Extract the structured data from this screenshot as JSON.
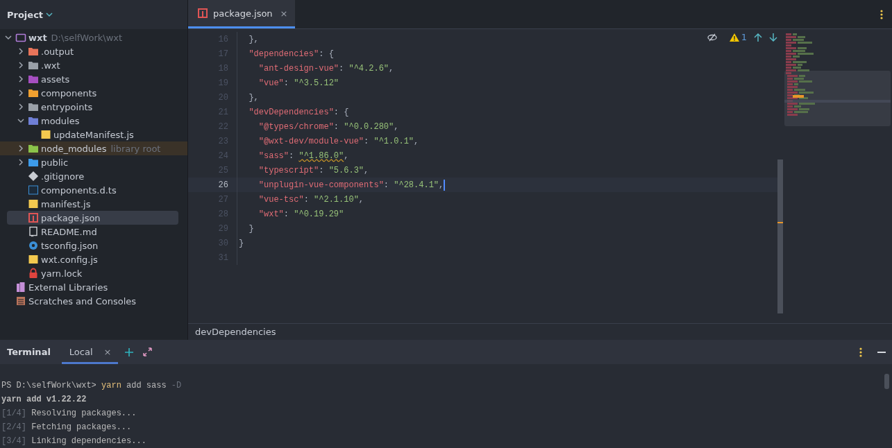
{
  "project": {
    "title": "Project",
    "tree": [
      {
        "name": "wxt",
        "path": "D:\\selfWork\\wxt",
        "kind": "module",
        "expanded": true,
        "selected": false,
        "children": [
          {
            "name": ".output",
            "kind": "folder",
            "color": "#e8745a",
            "expanded": false,
            "selected": false
          },
          {
            "name": ".wxt",
            "kind": "folder",
            "color": "#9aa0a8",
            "expanded": false,
            "selected": false
          },
          {
            "name": "assets",
            "kind": "folder",
            "color": "#a64fc1",
            "expanded": false,
            "selected": false
          },
          {
            "name": "components",
            "kind": "folder",
            "color": "#f0a030",
            "expanded": false,
            "selected": false
          },
          {
            "name": "entrypoints",
            "kind": "folder",
            "color": "#9aa0a8",
            "expanded": false,
            "selected": false
          },
          {
            "name": "modules",
            "kind": "folder",
            "color": "#6f7fd6",
            "expanded": true,
            "selected": false,
            "children": [
              {
                "name": "updateManifest.js",
                "kind": "js",
                "selected": false
              }
            ]
          },
          {
            "name": "node_modules",
            "kind": "folder",
            "color": "#8bc34a",
            "expanded": false,
            "selected": false,
            "library": true,
            "note": "library root"
          },
          {
            "name": "public",
            "kind": "folder",
            "color": "#3d9be9",
            "expanded": false,
            "selected": false
          },
          {
            "name": ".gitignore",
            "kind": "gitignore",
            "selected": false
          },
          {
            "name": "components.d.ts",
            "kind": "ts",
            "selected": false
          },
          {
            "name": "manifest.js",
            "kind": "js",
            "selected": false
          },
          {
            "name": "package.json",
            "kind": "json",
            "selected": true
          },
          {
            "name": "README.md",
            "kind": "md",
            "selected": false
          },
          {
            "name": "tsconfig.json",
            "kind": "tsconfig",
            "selected": false
          },
          {
            "name": "wxt.config.js",
            "kind": "js",
            "selected": false
          },
          {
            "name": "yarn.lock",
            "kind": "lock",
            "selected": false
          }
        ]
      },
      {
        "name": "External Libraries",
        "kind": "libraries",
        "selected": false
      },
      {
        "name": "Scratches and Consoles",
        "kind": "scratches",
        "selected": false
      }
    ]
  },
  "editor": {
    "tabs": [
      {
        "label": "package.json",
        "kind": "json",
        "selected": true,
        "close": "×"
      }
    ],
    "lines": [
      {
        "number": "16",
        "code": "  },",
        "current": false
      },
      {
        "number": "17",
        "code": "  \"dependencies\": {",
        "current": false
      },
      {
        "number": "18",
        "code": "    \"ant-design-vue\": \"^4.2.6\",",
        "current": false
      },
      {
        "number": "19",
        "code": "    \"vue\": \"^3.5.12\"",
        "current": false
      },
      {
        "number": "20",
        "code": "  },",
        "current": false
      },
      {
        "number": "21",
        "code": "  \"devDependencies\": {",
        "current": false
      },
      {
        "number": "22",
        "code": "    \"@types/chrome\": \"^0.0.280\",",
        "current": false
      },
      {
        "number": "23",
        "code": "    \"@wxt-dev/module-vue\": \"^1.0.1\",",
        "current": false
      },
      {
        "number": "24",
        "code": "    \"sass\": \"^1.86.0\",",
        "current": false,
        "warning": true
      },
      {
        "number": "25",
        "code": "    \"typescript\": \"5.6.3\",",
        "current": false
      },
      {
        "number": "26",
        "code": "    \"unplugin-vue-components\": \"^28.4.1\",",
        "current": true
      },
      {
        "number": "27",
        "code": "    \"vue-tsc\": \"^2.1.10\",",
        "current": false
      },
      {
        "number": "28",
        "code": "    \"wxt\": \"^0.19.29\"",
        "current": false
      },
      {
        "number": "29",
        "code": "  }",
        "current": false
      },
      {
        "number": "30",
        "code": "}",
        "current": false
      },
      {
        "number": "31",
        "current": false
      }
    ],
    "warnings": "1",
    "breadcrumb": "devDependencies"
  },
  "terminal": {
    "title": "Terminal",
    "tabs": [
      {
        "label": "Local",
        "selected": true,
        "close": "×"
      }
    ],
    "lines": [
      {
        "kind": "command",
        "prompt": "PS D:\\selfWork\\wxt>",
        "command": "yarn",
        "args": "add sass",
        "option": "-D"
      },
      {
        "kind": "bold",
        "text": "yarn add v1.22.22"
      },
      {
        "kind": "step",
        "step": "[1/4]",
        "text": "Resolving packages..."
      },
      {
        "kind": "step",
        "step": "[2/4]",
        "text": "Fetching packages..."
      },
      {
        "kind": "step",
        "step": "[3/4]",
        "text": "Linking dependencies..."
      }
    ]
  }
}
